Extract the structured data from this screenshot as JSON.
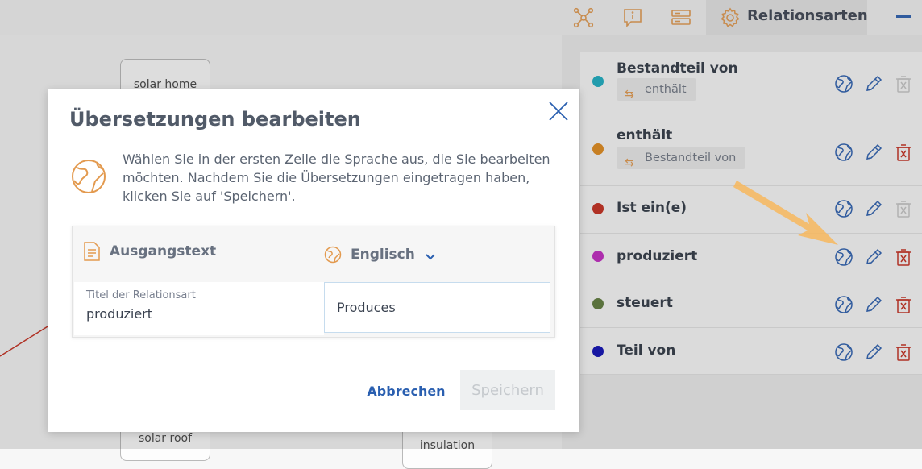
{
  "canvas": {
    "nodes": [
      {
        "label": "solar home"
      },
      {
        "label": "solar roof"
      },
      {
        "label": "insulation"
      }
    ]
  },
  "topbar": {
    "active_tab_label": "Relationsarten",
    "icons": [
      "network-icon",
      "info-icon",
      "list-icon",
      "gear-icon"
    ]
  },
  "panel": {
    "relations": [
      {
        "name": "Bestandteil von",
        "color": "#19aec3",
        "inverse": "enthält",
        "delete_enabled": false
      },
      {
        "name": "enthält",
        "color": "#e28a1a",
        "inverse": "Bestandteil von",
        "delete_enabled": true
      },
      {
        "name": "Ist ein(e)",
        "color": "#c62b1c",
        "inverse": "",
        "delete_enabled": false
      },
      {
        "name": "produziert",
        "color": "#c227c2",
        "inverse": "",
        "delete_enabled": true
      },
      {
        "name": "steuert",
        "color": "#5d7a3a",
        "inverse": "",
        "delete_enabled": true
      },
      {
        "name": "Teil von",
        "color": "#0b0bb5",
        "inverse": "",
        "delete_enabled": true
      }
    ]
  },
  "dialog": {
    "title": "Übersetzungen bearbeiten",
    "description": "Wählen Sie in der ersten Zeile die Sprache aus, die Sie bearbeiten möchten. Nachdem Sie die Übersetzungen eingetragen haben, klicken Sie auf 'Speichern'.",
    "table": {
      "source_header": "Ausgangstext",
      "language_selected": "Englisch",
      "field_label": "Titel der Relationsart",
      "source_value": "produziert",
      "translation_value": "Produces"
    },
    "cancel_label": "Abbrechen",
    "save_label": "Speichern"
  },
  "colors": {
    "accent": "#2a5fb0",
    "icon_orange": "#e39a4f",
    "delete_red": "#c62b1c"
  }
}
